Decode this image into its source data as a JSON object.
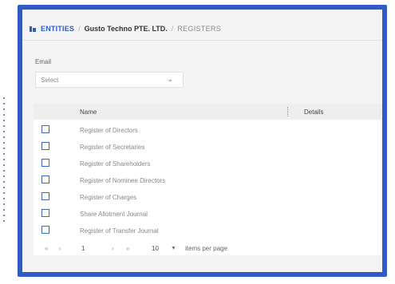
{
  "breadcrumb": {
    "entities": "ENTITIES",
    "separator": "/",
    "company": "Gusto Techno PTE. LTD.",
    "current": "REGISTERS"
  },
  "filter": {
    "label": "Email",
    "selected": "Select"
  },
  "table": {
    "columns": [
      "Name",
      "Details"
    ],
    "rows": [
      "Register of Directors",
      "Register of Secretaries",
      "Register of Shareholders",
      "Register of Nominee Directors",
      "Register of Charges",
      "Share Allotment Journal",
      "Register of Transfer Journal"
    ]
  },
  "pagination": {
    "first": "«",
    "prev": "‹",
    "page": "1",
    "next": "›",
    "last": "»",
    "page_size": "10",
    "per_page_label": "items per page"
  },
  "colors": {
    "accent": "#2f5bc4",
    "checkbox": "#3a66c8"
  }
}
